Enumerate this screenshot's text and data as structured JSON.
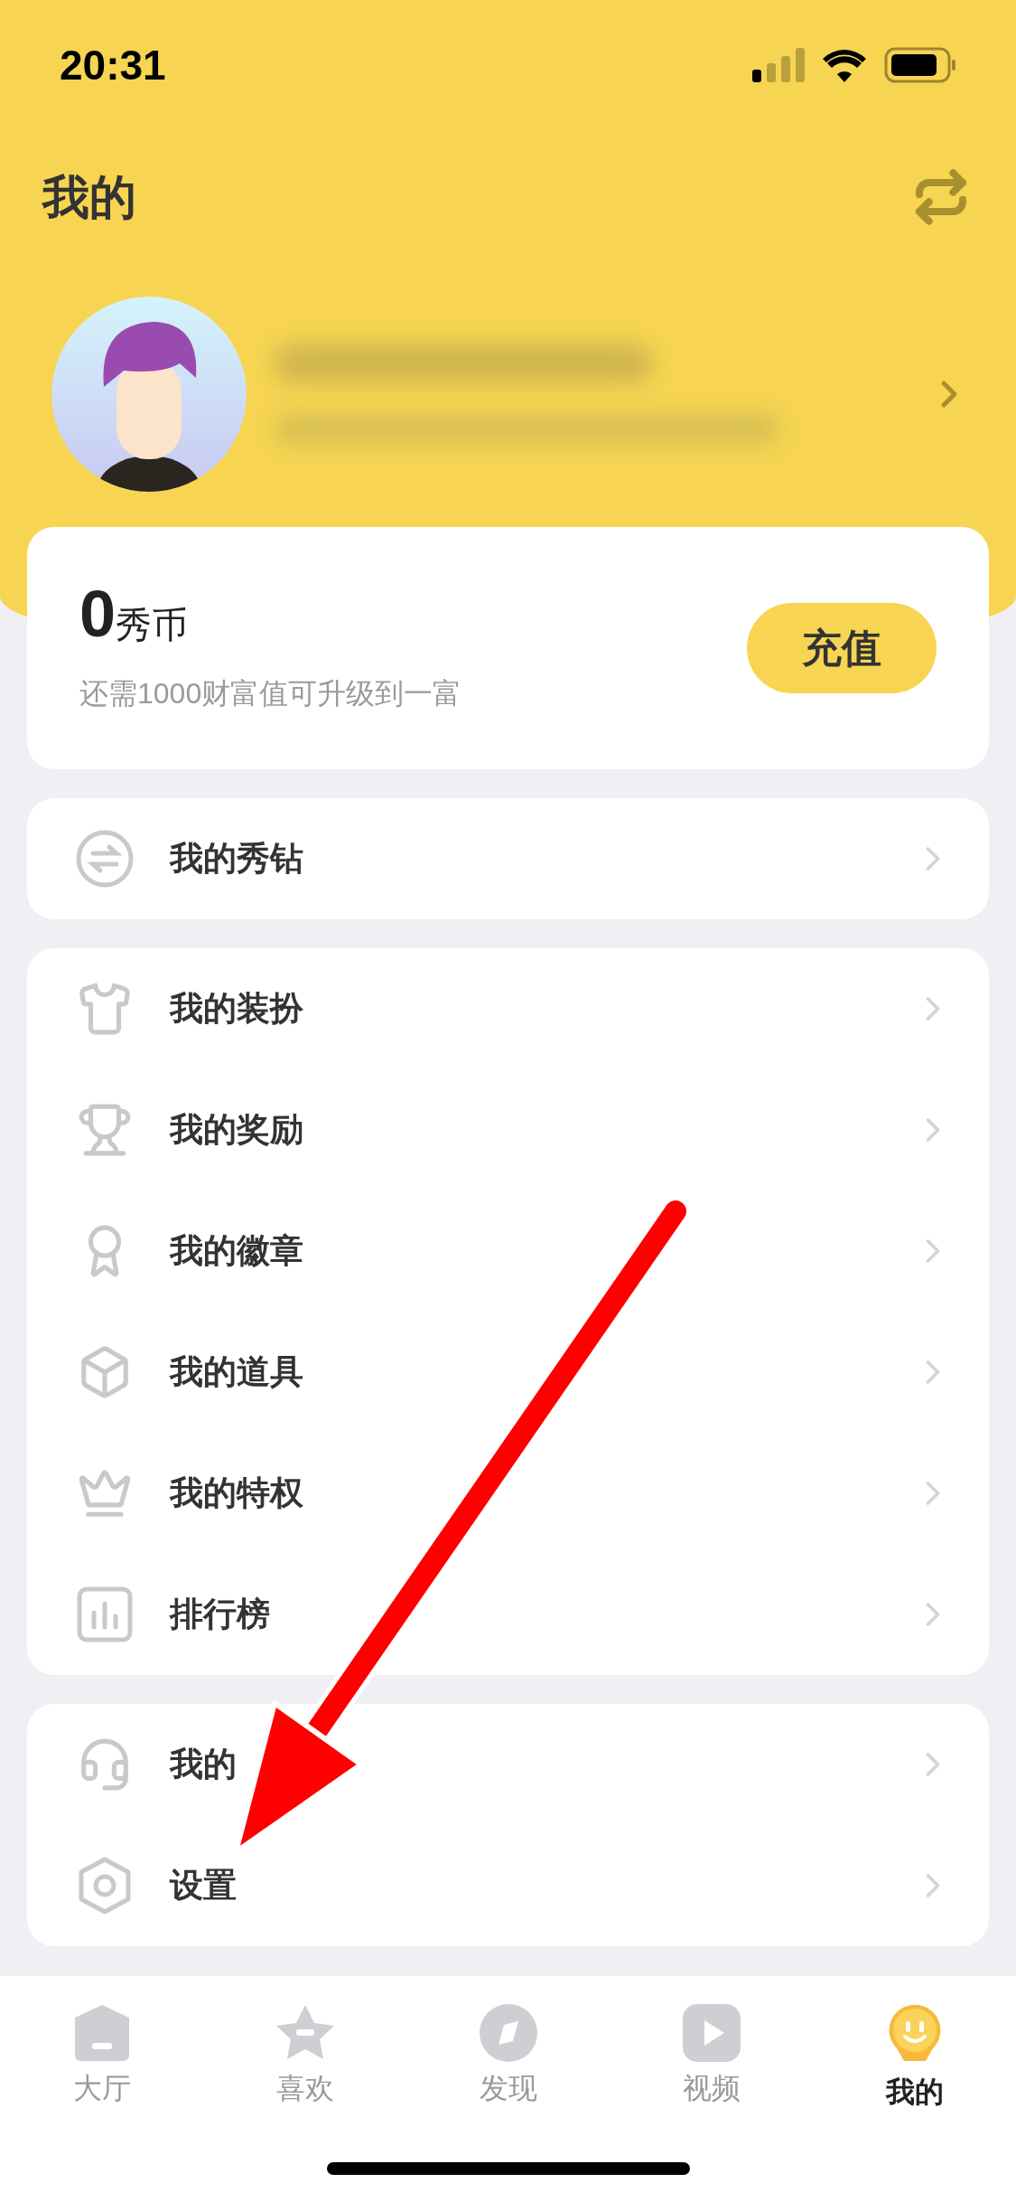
{
  "status_bar": {
    "time": "20:31"
  },
  "header": {
    "title": "我的"
  },
  "wallet": {
    "amount": "0",
    "unit": "秀币",
    "hint": "还需1000财富值可升级到一富",
    "button": "充值"
  },
  "menu_groups": [
    [
      {
        "kind": "exchange",
        "label": "我的秀钻"
      }
    ],
    [
      {
        "kind": "shirt",
        "label": "我的装扮"
      },
      {
        "kind": "trophy",
        "label": "我的奖励"
      },
      {
        "kind": "medal",
        "label": "我的徽章"
      },
      {
        "kind": "cube",
        "label": "我的道具"
      },
      {
        "kind": "crown",
        "label": "我的特权"
      },
      {
        "kind": "chart",
        "label": "排行榜"
      }
    ],
    [
      {
        "kind": "headset",
        "label": "我的"
      },
      {
        "kind": "settings",
        "label": "设置"
      }
    ]
  ],
  "tabs": [
    {
      "kind": "home",
      "label": "大厅",
      "selected": false
    },
    {
      "kind": "star",
      "label": "喜欢",
      "selected": false
    },
    {
      "kind": "compass",
      "label": "发现",
      "selected": false
    },
    {
      "kind": "video",
      "label": "视频",
      "selected": false
    },
    {
      "kind": "me",
      "label": "我的",
      "selected": true
    }
  ]
}
